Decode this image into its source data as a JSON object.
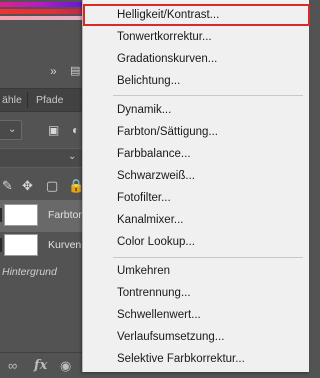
{
  "layers_panel": {
    "tabs": [
      "ähle",
      "Pfade"
    ],
    "layers": [
      {
        "name": "Farbton",
        "selected": true
      },
      {
        "name": "Kurven",
        "selected": false
      }
    ],
    "background_layer": "Hintergrund",
    "icons": {
      "panel_menu": "collapse-arrows-icon",
      "panel_options": "panel-options-icon",
      "image_filter": "image-filter-icon",
      "adjustment_filter": "adjustment-filter-icon",
      "brush_lock": "brush-lock-icon",
      "move_lock": "move-lock-icon",
      "artboard_lock": "artboard-lock-icon",
      "all_lock": "lock-icon",
      "link": "link-layers-icon",
      "fx": "fx-icon",
      "mask": "add-mask-icon"
    }
  },
  "menu": {
    "groups": [
      [
        "Helligkeit/Kontrast...",
        "Tonwertkorrektur...",
        "Gradationskurven...",
        "Belichtung..."
      ],
      [
        "Dynamik...",
        "Farbton/Sättigung...",
        "Farbbalance...",
        "Schwarzweiß...",
        "Fotofilter...",
        "Kanalmixer...",
        "Color Lookup..."
      ],
      [
        "Umkehren",
        "Tontrennung...",
        "Schwellenwert...",
        "Verlaufsumsetzung...",
        "Selektive Farbkorrektur..."
      ]
    ],
    "highlighted_item": "Helligkeit/Kontrast...",
    "highlight_color": "#d92a2a"
  }
}
